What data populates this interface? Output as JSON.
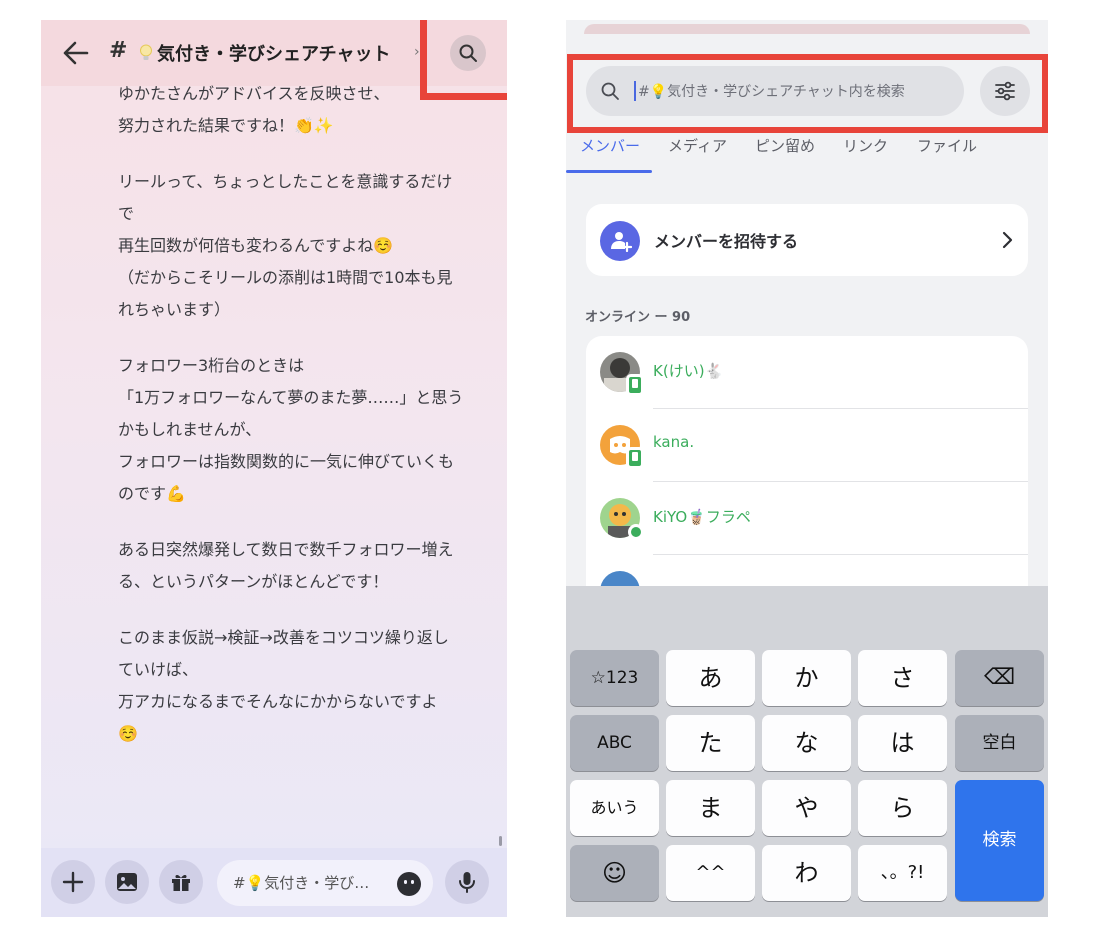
{
  "left": {
    "channel_hash": "#",
    "channel_title": "気付き・学びシェアチャット",
    "title_more": "›",
    "messages": [
      [
        "ゆかたさんがアドバイスを反映させ、",
        "努力された結果ですね！👏✨"
      ],
      [
        "リールって、ちょっとしたことを意識するだけ",
        "で",
        "再生回数が何倍も変わるんですよね☺️",
        "（だからこそリールの添削は1時間で10本も見",
        "れちゃいます）"
      ],
      [
        "フォロワー3桁台のときは",
        "「1万フォロワーなんて夢のまた夢……」と思う",
        "かもしれませんが、",
        "フォロワーは指数関数的に一気に伸びていくも",
        "のです💪"
      ],
      [
        "ある日突然爆発して数日で数千フォロワー増え",
        "る、というパターンがほとんどです！"
      ],
      [
        "このまま仮説→検証→改善をコツコツ繰り返し",
        "ていけば、",
        "万アカになるまでそんなにかからないですよ",
        "☺️"
      ]
    ],
    "composer_placeholder": "#💡気付き・学び…"
  },
  "right": {
    "search_placeholder": "#💡気付き・学びシェアチャット内を検索",
    "tabs": [
      "メンバー",
      "メディア",
      "ピン留め",
      "リンク",
      "ファイル"
    ],
    "active_tab": "メンバー",
    "invite_label": "メンバーを招待する",
    "online_header": "オンライン ー 90",
    "members": [
      {
        "name": "K(けい)🐇",
        "status": "mobile"
      },
      {
        "name": "kana.",
        "status": "mobile"
      },
      {
        "name": "KiYO🧋フラペ",
        "status": "online"
      }
    ],
    "keyboard": {
      "row1": [
        "☆123",
        "あ",
        "か",
        "さ",
        "⌫"
      ],
      "row2": [
        "ABC",
        "た",
        "な",
        "は",
        "空白"
      ],
      "row3": [
        "あいう",
        "ま",
        "や",
        "ら"
      ],
      "row4": [
        "☺",
        "^^",
        "わ",
        "、。?!"
      ],
      "enter": "検索"
    }
  },
  "colors": {
    "accent_blue": "#4a6bea",
    "online_green": "#3bad5c",
    "highlight_red": "#e8443a",
    "key_blue": "#2f74ec"
  }
}
